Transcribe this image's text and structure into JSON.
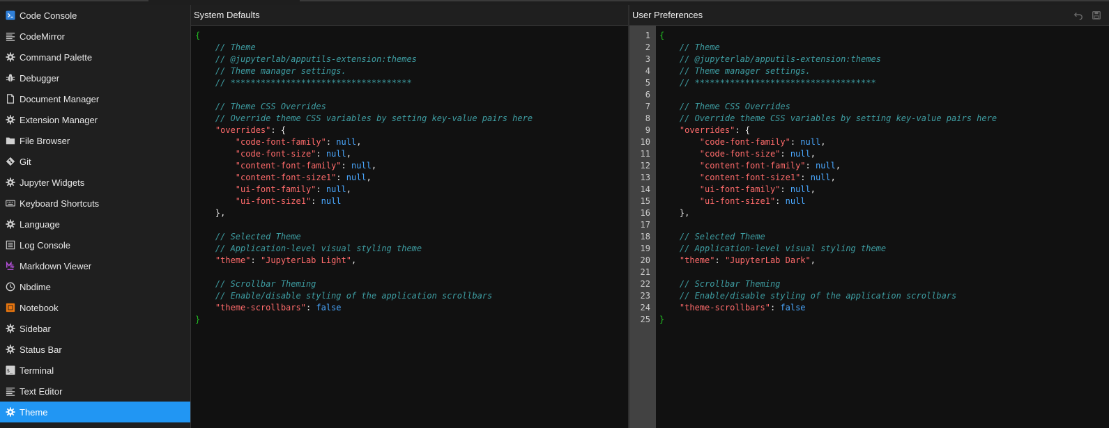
{
  "sidebar": {
    "items": [
      {
        "label": "Code Console",
        "icon": "code-console-icon",
        "active": false
      },
      {
        "label": "CodeMirror",
        "icon": "text-lines-icon",
        "active": false
      },
      {
        "label": "Command Palette",
        "icon": "gear-icon",
        "active": false
      },
      {
        "label": "Debugger",
        "icon": "bug-icon",
        "active": false
      },
      {
        "label": "Document Manager",
        "icon": "document-icon",
        "active": false
      },
      {
        "label": "Extension Manager",
        "icon": "gear-icon",
        "active": false
      },
      {
        "label": "File Browser",
        "icon": "folder-icon",
        "active": false
      },
      {
        "label": "Git",
        "icon": "git-icon",
        "active": false
      },
      {
        "label": "Jupyter Widgets",
        "icon": "gear-icon",
        "active": false
      },
      {
        "label": "Keyboard Shortcuts",
        "icon": "keyboard-icon",
        "active": false
      },
      {
        "label": "Language",
        "icon": "gear-icon",
        "active": false
      },
      {
        "label": "Log Console",
        "icon": "list-icon",
        "active": false
      },
      {
        "label": "Markdown Viewer",
        "icon": "markdown-icon",
        "active": false
      },
      {
        "label": "Nbdime",
        "icon": "clock-icon",
        "active": false
      },
      {
        "label": "Notebook",
        "icon": "notebook-icon",
        "active": false
      },
      {
        "label": "Sidebar",
        "icon": "gear-icon",
        "active": false
      },
      {
        "label": "Status Bar",
        "icon": "gear-icon",
        "active": false
      },
      {
        "label": "Terminal",
        "icon": "terminal-icon",
        "active": false
      },
      {
        "label": "Text Editor",
        "icon": "text-lines-icon",
        "active": false
      },
      {
        "label": "Theme",
        "icon": "gear-icon",
        "active": true
      }
    ]
  },
  "left_panel": {
    "title": "System Defaults"
  },
  "right_panel": {
    "title": "User Preferences",
    "line_numbers": [
      "1",
      "2",
      "3",
      "4",
      "5",
      "6",
      "7",
      "8",
      "9",
      "10",
      "11",
      "12",
      "13",
      "14",
      "15",
      "16",
      "17",
      "18",
      "19",
      "20",
      "21",
      "22",
      "23",
      "24",
      "25"
    ]
  },
  "colors": {
    "accent": "#2196f3",
    "comment": "#3e9ea3",
    "string": "#ff6b6b",
    "null": "#4aa8ff",
    "brace": "#22bb22"
  },
  "code_left": [
    [
      [
        "brace",
        "{"
      ]
    ],
    [
      [
        "ws",
        "    "
      ],
      [
        "comment",
        "// Theme"
      ]
    ],
    [
      [
        "ws",
        "    "
      ],
      [
        "comment",
        "// @jupyterlab/apputils-extension:themes"
      ]
    ],
    [
      [
        "ws",
        "    "
      ],
      [
        "comment",
        "// Theme manager settings."
      ]
    ],
    [
      [
        "ws",
        "    "
      ],
      [
        "comment",
        "// ************************************"
      ]
    ],
    [],
    [
      [
        "ws",
        "    "
      ],
      [
        "comment",
        "// Theme CSS Overrides"
      ]
    ],
    [
      [
        "ws",
        "    "
      ],
      [
        "comment",
        "// Override theme CSS variables by setting key-value pairs here"
      ]
    ],
    [
      [
        "ws",
        "    "
      ],
      [
        "key",
        "\"overrides\""
      ],
      [
        "punct",
        ": {"
      ]
    ],
    [
      [
        "ws",
        "        "
      ],
      [
        "key",
        "\"code-font-family\""
      ],
      [
        "punct",
        ": "
      ],
      [
        "null",
        "null"
      ],
      [
        "punct",
        ","
      ]
    ],
    [
      [
        "ws",
        "        "
      ],
      [
        "key",
        "\"code-font-size\""
      ],
      [
        "punct",
        ": "
      ],
      [
        "null",
        "null"
      ],
      [
        "punct",
        ","
      ]
    ],
    [
      [
        "ws",
        "        "
      ],
      [
        "key",
        "\"content-font-family\""
      ],
      [
        "punct",
        ": "
      ],
      [
        "null",
        "null"
      ],
      [
        "punct",
        ","
      ]
    ],
    [
      [
        "ws",
        "        "
      ],
      [
        "key",
        "\"content-font-size1\""
      ],
      [
        "punct",
        ": "
      ],
      [
        "null",
        "null"
      ],
      [
        "punct",
        ","
      ]
    ],
    [
      [
        "ws",
        "        "
      ],
      [
        "key",
        "\"ui-font-family\""
      ],
      [
        "punct",
        ": "
      ],
      [
        "null",
        "null"
      ],
      [
        "punct",
        ","
      ]
    ],
    [
      [
        "ws",
        "        "
      ],
      [
        "key",
        "\"ui-font-size1\""
      ],
      [
        "punct",
        ": "
      ],
      [
        "null",
        "null"
      ]
    ],
    [
      [
        "ws",
        "    "
      ],
      [
        "punct",
        "},"
      ]
    ],
    [],
    [
      [
        "ws",
        "    "
      ],
      [
        "comment",
        "// Selected Theme"
      ]
    ],
    [
      [
        "ws",
        "    "
      ],
      [
        "comment",
        "// Application-level visual styling theme"
      ]
    ],
    [
      [
        "ws",
        "    "
      ],
      [
        "key",
        "\"theme\""
      ],
      [
        "punct",
        ": "
      ],
      [
        "str",
        "\"JupyterLab Light\""
      ],
      [
        "punct",
        ","
      ]
    ],
    [],
    [
      [
        "ws",
        "    "
      ],
      [
        "comment",
        "// Scrollbar Theming"
      ]
    ],
    [
      [
        "ws",
        "    "
      ],
      [
        "comment",
        "// Enable/disable styling of the application scrollbars"
      ]
    ],
    [
      [
        "ws",
        "    "
      ],
      [
        "key",
        "\"theme-scrollbars\""
      ],
      [
        "punct",
        ": "
      ],
      [
        "null",
        "false"
      ]
    ],
    [
      [
        "brace",
        "}"
      ]
    ]
  ],
  "code_right": [
    [
      [
        "brace",
        "{"
      ]
    ],
    [
      [
        "ws",
        "    "
      ],
      [
        "comment",
        "// Theme"
      ]
    ],
    [
      [
        "ws",
        "    "
      ],
      [
        "comment",
        "// @jupyterlab/apputils-extension:themes"
      ]
    ],
    [
      [
        "ws",
        "    "
      ],
      [
        "comment",
        "// Theme manager settings."
      ]
    ],
    [
      [
        "ws",
        "    "
      ],
      [
        "comment",
        "// ************************************"
      ]
    ],
    [],
    [
      [
        "ws",
        "    "
      ],
      [
        "comment",
        "// Theme CSS Overrides"
      ]
    ],
    [
      [
        "ws",
        "    "
      ],
      [
        "comment",
        "// Override theme CSS variables by setting key-value pairs here"
      ]
    ],
    [
      [
        "ws",
        "    "
      ],
      [
        "key",
        "\"overrides\""
      ],
      [
        "punct",
        ": {"
      ]
    ],
    [
      [
        "ws",
        "        "
      ],
      [
        "key",
        "\"code-font-family\""
      ],
      [
        "punct",
        ": "
      ],
      [
        "null",
        "null"
      ],
      [
        "punct",
        ","
      ]
    ],
    [
      [
        "ws",
        "        "
      ],
      [
        "key",
        "\"code-font-size\""
      ],
      [
        "punct",
        ": "
      ],
      [
        "null",
        "null"
      ],
      [
        "punct",
        ","
      ]
    ],
    [
      [
        "ws",
        "        "
      ],
      [
        "key",
        "\"content-font-family\""
      ],
      [
        "punct",
        ": "
      ],
      [
        "null",
        "null"
      ],
      [
        "punct",
        ","
      ]
    ],
    [
      [
        "ws",
        "        "
      ],
      [
        "key",
        "\"content-font-size1\""
      ],
      [
        "punct",
        ": "
      ],
      [
        "null",
        "null"
      ],
      [
        "punct",
        ","
      ]
    ],
    [
      [
        "ws",
        "        "
      ],
      [
        "key",
        "\"ui-font-family\""
      ],
      [
        "punct",
        ": "
      ],
      [
        "null",
        "null"
      ],
      [
        "punct",
        ","
      ]
    ],
    [
      [
        "ws",
        "        "
      ],
      [
        "key",
        "\"ui-font-size1\""
      ],
      [
        "punct",
        ": "
      ],
      [
        "null",
        "null"
      ]
    ],
    [
      [
        "ws",
        "    "
      ],
      [
        "punct",
        "},"
      ]
    ],
    [],
    [
      [
        "ws",
        "    "
      ],
      [
        "comment",
        "// Selected Theme"
      ]
    ],
    [
      [
        "ws",
        "    "
      ],
      [
        "comment",
        "// Application-level visual styling theme"
      ]
    ],
    [
      [
        "ws",
        "    "
      ],
      [
        "key",
        "\"theme\""
      ],
      [
        "punct",
        ": "
      ],
      [
        "str",
        "\"JupyterLab Dark\""
      ],
      [
        "punct",
        ","
      ]
    ],
    [],
    [
      [
        "ws",
        "    "
      ],
      [
        "comment",
        "// Scrollbar Theming"
      ]
    ],
    [
      [
        "ws",
        "    "
      ],
      [
        "comment",
        "// Enable/disable styling of the application scrollbars"
      ]
    ],
    [
      [
        "ws",
        "    "
      ],
      [
        "key",
        "\"theme-scrollbars\""
      ],
      [
        "punct",
        ": "
      ],
      [
        "null",
        "false"
      ]
    ],
    [
      [
        "brace",
        "}"
      ]
    ]
  ]
}
